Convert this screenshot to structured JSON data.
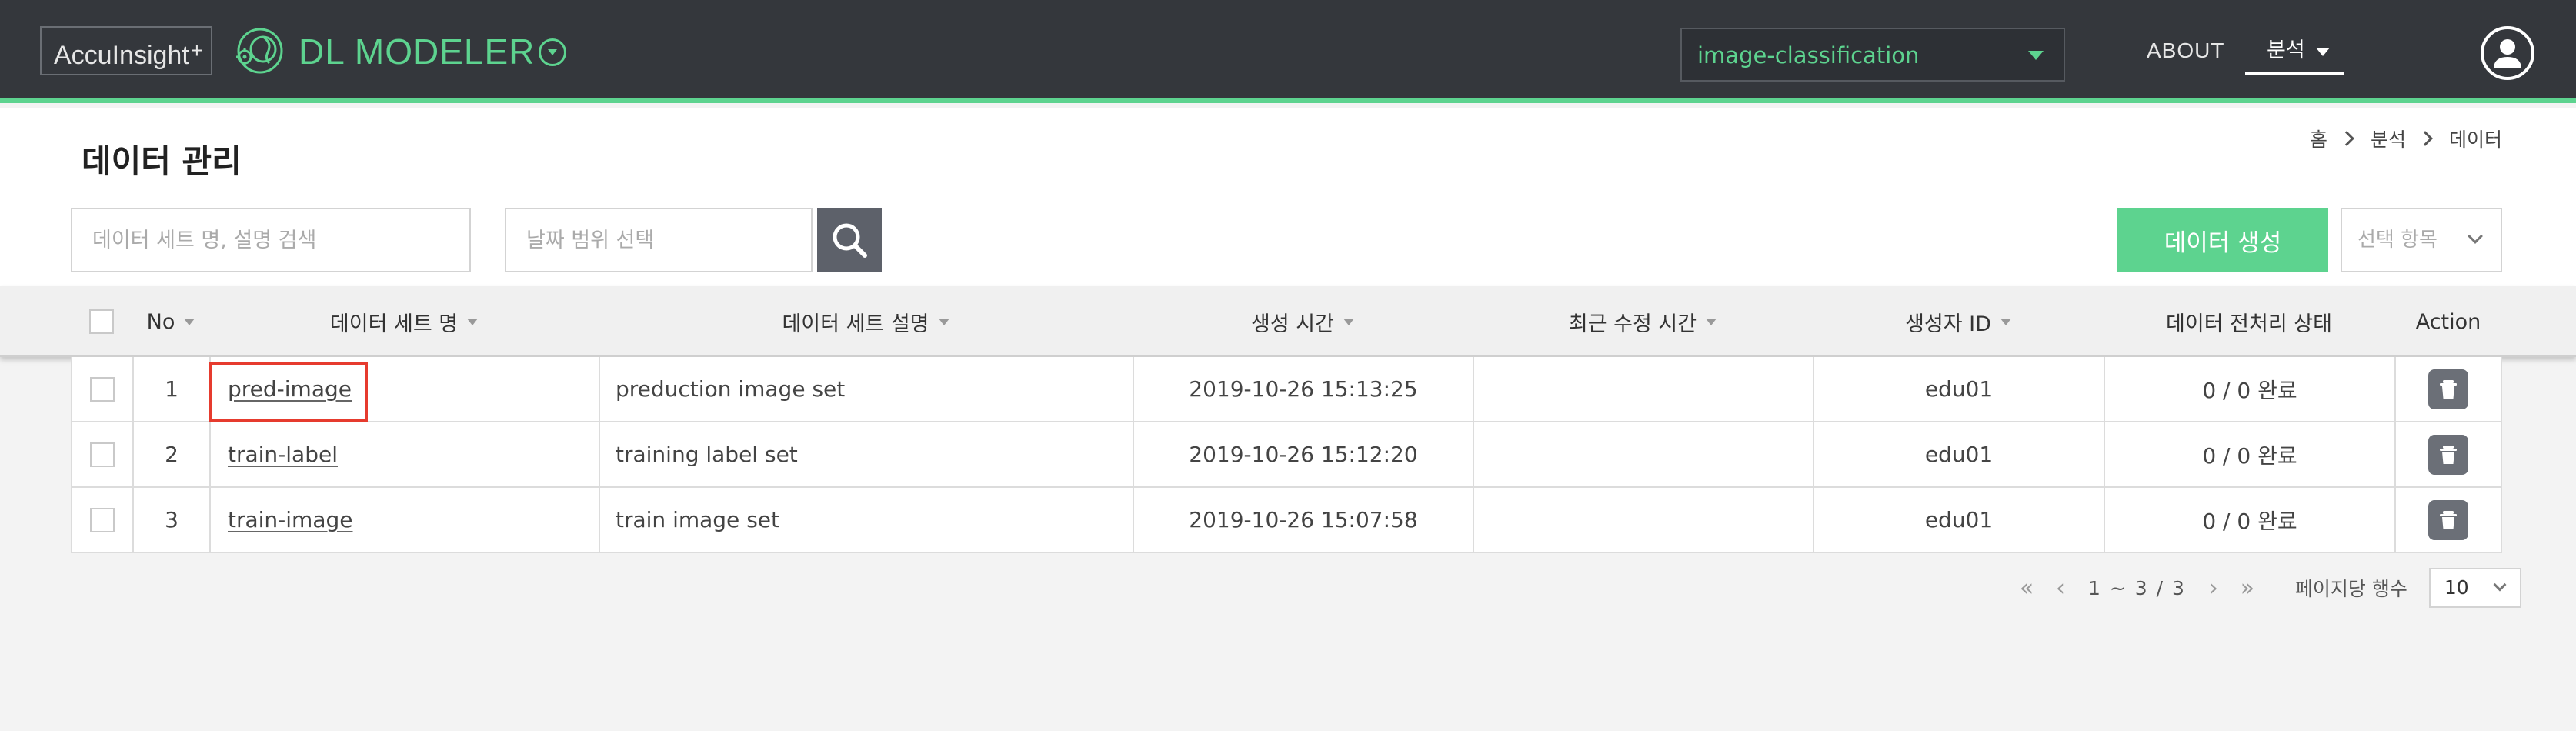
{
  "brand": {
    "name": "AccuInsight",
    "plus": "+"
  },
  "app": {
    "title": "DL MODELER"
  },
  "project_select": {
    "value": "image-classification"
  },
  "nav": {
    "about": "ABOUT",
    "analysis": "분석"
  },
  "page": {
    "title": "데이터 관리"
  },
  "breadcrumb": {
    "items": [
      "홈",
      "분석",
      "데이터"
    ]
  },
  "search": {
    "placeholder": "데이터 세트 명, 설명 검색"
  },
  "date_range": {
    "placeholder": "날짜 범위 선택"
  },
  "actions": {
    "create_label": "데이터 생성",
    "select_items": "선택 항목"
  },
  "table": {
    "headers": {
      "no": "No",
      "name": "데이터 세트 명",
      "description": "데이터 세트 설명",
      "created": "생성 시간",
      "modified": "최근 수정 시간",
      "creator": "생성자 ID",
      "status": "데이터 전처리 상태",
      "action": "Action"
    },
    "rows": [
      {
        "no": "1",
        "name": "pred-image",
        "description": "preduction image set",
        "created": "2019-10-26 15:13:25",
        "modified": "",
        "creator": "edu01",
        "status": "0 / 0 완료"
      },
      {
        "no": "2",
        "name": "train-label",
        "description": "training label set",
        "created": "2019-10-26 15:12:20",
        "modified": "",
        "creator": "edu01",
        "status": "0 / 0 완료"
      },
      {
        "no": "3",
        "name": "train-image",
        "description": "train image set",
        "created": "2019-10-26 15:07:58",
        "modified": "",
        "creator": "edu01",
        "status": "0 / 0 완료"
      }
    ]
  },
  "pagination": {
    "info": "1 ~ 3 / 3",
    "rows_label": "페이지당 행수",
    "rows_value": "10"
  },
  "colors": {
    "accent": "#5dd38f",
    "topbar": "#34373c",
    "highlight": "#e63b2e"
  },
  "icons": [
    "logo-icon",
    "dropdown-icon",
    "user-icon",
    "search-icon",
    "trash-icon",
    "chevron-icons"
  ]
}
